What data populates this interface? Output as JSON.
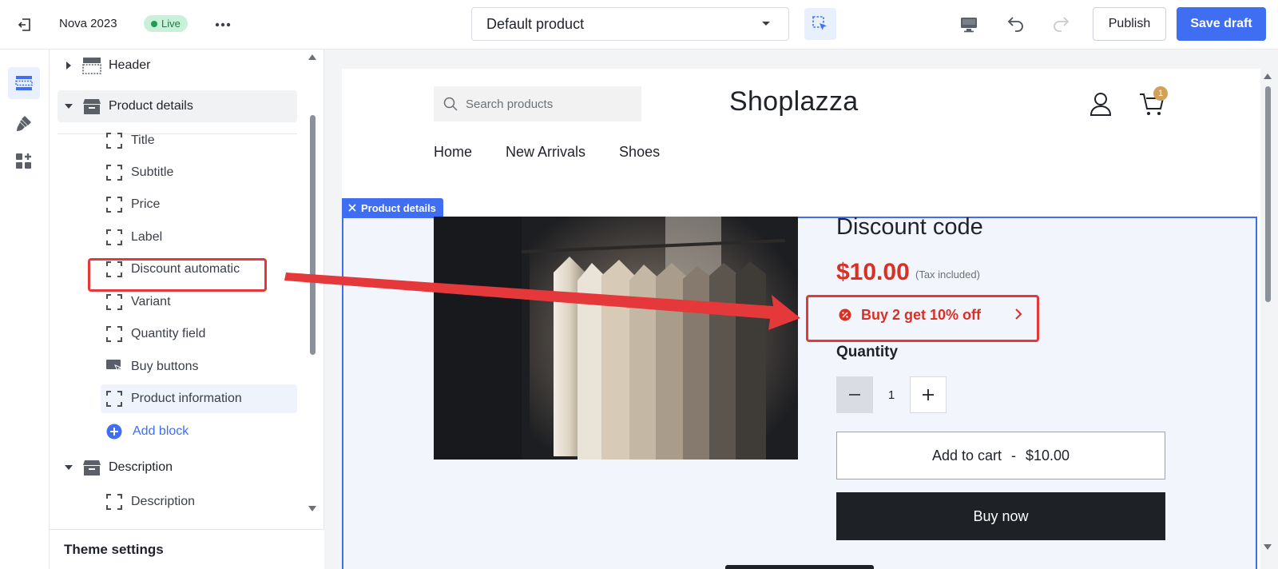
{
  "topbar": {
    "store_name": "Nova 2023",
    "status_badge": "Live",
    "template_select": "Default product",
    "publish_label": "Publish",
    "save_label": "Save draft"
  },
  "sidebar": {
    "sections": [
      {
        "label": "Header",
        "expanded": false
      },
      {
        "label": "Product details",
        "expanded": true
      },
      {
        "label": "Description",
        "expanded": true
      }
    ],
    "product_blocks": [
      "Title",
      "Subtitle",
      "Price",
      "Label",
      "Discount automatic",
      "Variant",
      "Quantity field",
      "Buy buttons",
      "Product information"
    ],
    "add_block_label": "Add block",
    "description_blocks": [
      "Description"
    ],
    "theme_settings_label": "Theme settings"
  },
  "preview": {
    "search_placeholder": "Search products",
    "brand": "Shoplazza",
    "cart_count": "1",
    "nav": [
      "Home",
      "New Arrivals",
      "Shoes"
    ],
    "section_tag": "Product details",
    "product_title": "Discount code",
    "price": "$10.00",
    "tax_note": "(Tax included)",
    "discount_text": "Buy 2 get 10% off",
    "quantity_label": "Quantity",
    "quantity_value": "1",
    "add_to_cart_label": "Add to cart",
    "add_to_cart_sep": "-",
    "add_to_cart_price": "$10.00",
    "buy_now_label": "Buy now"
  },
  "colors": {
    "accent": "#3f6ef3",
    "price_red": "#d93025",
    "annotation_red": "#e5383b",
    "live_green": "#1b9e52"
  },
  "icons": [
    "exit-icon",
    "more-icon",
    "chevron-down-icon",
    "inspect-icon",
    "desktop-icon",
    "undo-icon",
    "redo-icon",
    "sections-icon",
    "paint-icon",
    "apps-icon",
    "search-icon",
    "user-icon",
    "cart-icon",
    "close-icon",
    "discount-icon",
    "chevron-right-icon",
    "minus-icon",
    "plus-icon"
  ]
}
